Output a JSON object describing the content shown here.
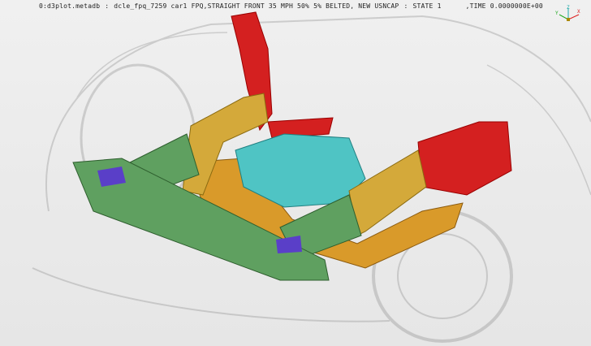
{
  "header": {
    "file": "0:d3plot.metadb",
    "sep1": ":",
    "title": "dcle_fpq_7259 car1 FPQ,STRAIGHT FRONT 35 MPH 50% 5% BELTED, NEW USNCAP",
    "sep2": ":",
    "state": "STATE 1",
    "time": ",TIME 0.0000000E+00"
  },
  "triad": {
    "x": "X",
    "y": "Y",
    "z": "Z"
  },
  "colors": {
    "bumper": "#5fa060",
    "rails": "#d4a93a",
    "engine": "#4fc4c4",
    "apron": "#d42020",
    "subframe": "#d99a2a",
    "brackets": "#5a3fc8"
  }
}
